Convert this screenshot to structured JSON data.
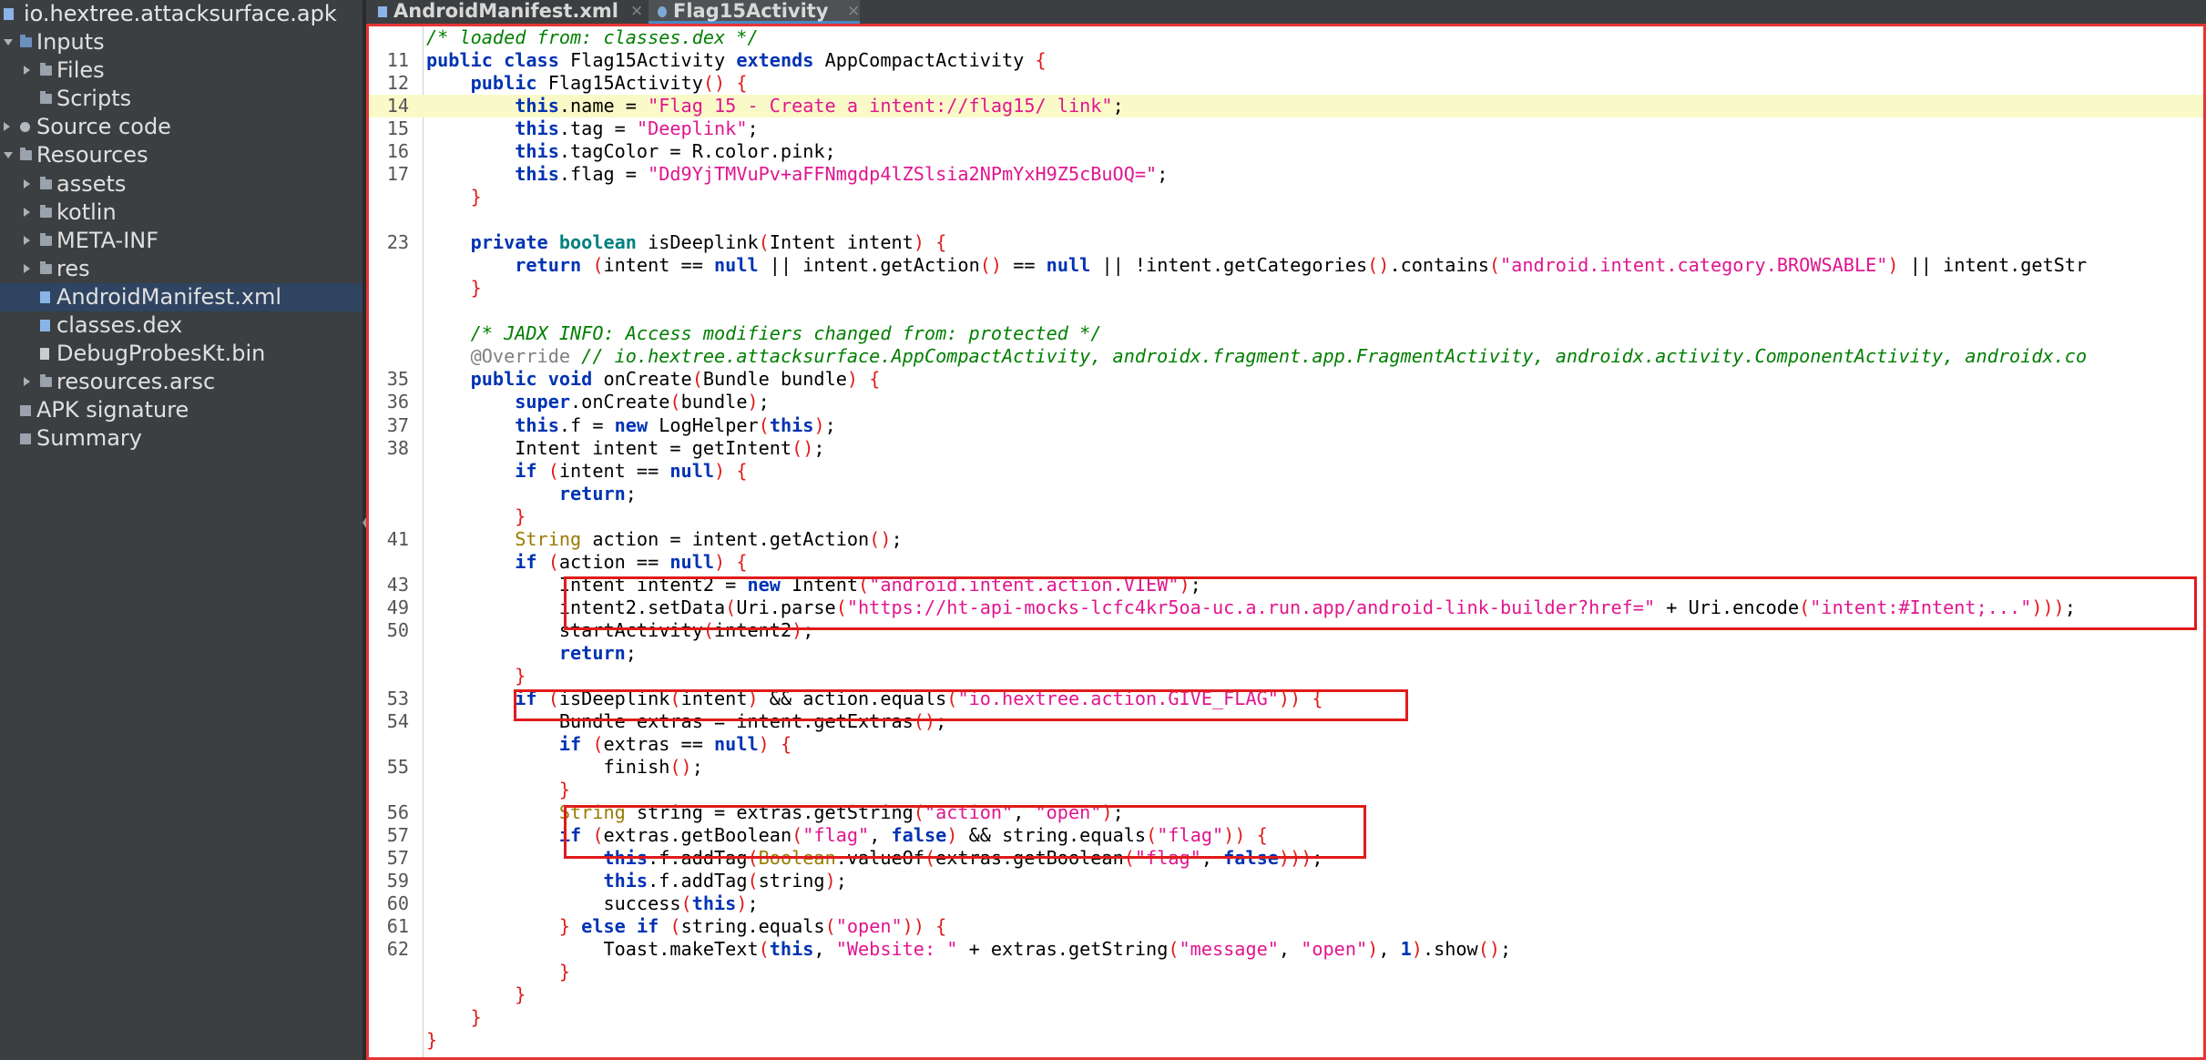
{
  "project": {
    "title": "io.hextree.attacksurface.apk"
  },
  "tree": [
    {
      "label": "Inputs",
      "arrow": "down",
      "icon": "inputs-icon",
      "indent": 0
    },
    {
      "label": "Files",
      "arrow": "right",
      "icon": "folder-icon",
      "indent": 1
    },
    {
      "label": "Scripts",
      "arrow": "",
      "icon": "folder-icon",
      "indent": 1
    },
    {
      "label": "Source code",
      "arrow": "right",
      "icon": "package-icon",
      "indent": 0
    },
    {
      "label": "Resources",
      "arrow": "down",
      "icon": "folder-icon",
      "indent": 0
    },
    {
      "label": "assets",
      "arrow": "right",
      "icon": "folder-icon",
      "indent": 1
    },
    {
      "label": "kotlin",
      "arrow": "right",
      "icon": "folder-icon",
      "indent": 1
    },
    {
      "label": "META-INF",
      "arrow": "right",
      "icon": "folder-icon",
      "indent": 1
    },
    {
      "label": "res",
      "arrow": "right",
      "icon": "folder-icon",
      "indent": 1
    },
    {
      "label": "AndroidManifest.xml",
      "arrow": "",
      "icon": "xml-file-icon",
      "indent": 1,
      "selected": true
    },
    {
      "label": "classes.dex",
      "arrow": "",
      "icon": "dex-file-icon",
      "indent": 1
    },
    {
      "label": "DebugProbesKt.bin",
      "arrow": "",
      "icon": "file-icon",
      "indent": 1
    },
    {
      "label": "resources.arsc",
      "arrow": "right",
      "icon": "folder-icon",
      "indent": 1
    },
    {
      "label": "APK signature",
      "arrow": "",
      "icon": "signature-icon",
      "indent": 0
    },
    {
      "label": "Summary",
      "arrow": "",
      "icon": "summary-icon",
      "indent": 0
    }
  ],
  "tabs": [
    {
      "label": "AndroidManifest.xml",
      "active": false,
      "close": "×"
    },
    {
      "label": "Flag15Activity",
      "active": true,
      "close": "×"
    }
  ],
  "code": [
    {
      "ln": "",
      "spans": [
        [
          "cm",
          "/* loaded from: classes.dex */"
        ]
      ]
    },
    {
      "ln": "11",
      "spans": [
        [
          "kw",
          "public class "
        ],
        [
          "",
          "Flag15Activity "
        ],
        [
          "kw",
          "extends "
        ],
        [
          "",
          "AppCompactActivity "
        ],
        [
          "pr",
          "{"
        ]
      ]
    },
    {
      "ln": "12",
      "spans": [
        [
          "",
          "    "
        ],
        [
          "kw",
          "public "
        ],
        [
          "",
          "Flag15Activity"
        ],
        [
          "pr",
          "() {"
        ]
      ]
    },
    {
      "ln": "14",
      "hl": true,
      "spans": [
        [
          "",
          "        "
        ],
        [
          "kw",
          "this"
        ],
        [
          "",
          ".name = "
        ],
        [
          "str",
          "\"Flag 15 - Create a intent://flag15/ link\""
        ],
        [
          "",
          ";"
        ]
      ]
    },
    {
      "ln": "15",
      "spans": [
        [
          "",
          "        "
        ],
        [
          "kw",
          "this"
        ],
        [
          "",
          ".tag = "
        ],
        [
          "str",
          "\"Deeplink\""
        ],
        [
          "",
          ";"
        ]
      ]
    },
    {
      "ln": "16",
      "spans": [
        [
          "",
          "        "
        ],
        [
          "kw",
          "this"
        ],
        [
          "",
          ".tagColor = R.color.pink;"
        ]
      ]
    },
    {
      "ln": "17",
      "spans": [
        [
          "",
          "        "
        ],
        [
          "kw",
          "this"
        ],
        [
          "",
          ".flag = "
        ],
        [
          "str",
          "\"Dd9YjTMVuPv+aFFNmgdp4lZSlsia2NPmYxH9Z5cBuOQ=\""
        ],
        [
          "",
          ";"
        ]
      ]
    },
    {
      "ln": "",
      "spans": [
        [
          "",
          "    "
        ],
        [
          "pr",
          "}"
        ]
      ]
    },
    {
      "ln": "",
      "spans": [
        [
          "",
          ""
        ]
      ]
    },
    {
      "ln": "23",
      "spans": [
        [
          "",
          "    "
        ],
        [
          "kw",
          "private "
        ],
        [
          "kw2",
          "boolean "
        ],
        [
          "",
          "isDeeplink"
        ],
        [
          "pr",
          "("
        ],
        [
          "",
          "Intent intent"
        ],
        [
          "pr",
          ") {"
        ]
      ]
    },
    {
      "ln": "",
      "spans": [
        [
          "",
          "        "
        ],
        [
          "kw",
          "return "
        ],
        [
          "pr",
          "("
        ],
        [
          "",
          "intent == "
        ],
        [
          "kw",
          "null "
        ],
        [
          "",
          "|| intent.getAction"
        ],
        [
          "pr",
          "()"
        ],
        [
          "",
          " == "
        ],
        [
          "kw",
          "null "
        ],
        [
          "",
          "|| !intent.getCategories"
        ],
        [
          "pr",
          "()"
        ],
        [
          "",
          ".contains"
        ],
        [
          "pr",
          "("
        ],
        [
          "str",
          "\"android.intent.category.BROWSABLE\""
        ],
        [
          "pr",
          ")"
        ],
        [
          "",
          " || intent.getStr"
        ]
      ]
    },
    {
      "ln": "",
      "spans": [
        [
          "",
          "    "
        ],
        [
          "pr",
          "}"
        ]
      ]
    },
    {
      "ln": "",
      "spans": [
        [
          "",
          ""
        ]
      ]
    },
    {
      "ln": "",
      "spans": [
        [
          "",
          "    "
        ],
        [
          "cm",
          "/* JADX INFO: Access modifiers changed from: protected */"
        ]
      ]
    },
    {
      "ln": "",
      "spans": [
        [
          "",
          "    "
        ],
        [
          "ann",
          "@Override "
        ],
        [
          "cm",
          "// io.hextree.attacksurface.AppCompactActivity, androidx.fragment.app.FragmentActivity, androidx.activity.ComponentActivity, androidx.co"
        ]
      ]
    },
    {
      "ln": "35",
      "spans": [
        [
          "",
          "    "
        ],
        [
          "kw",
          "public void "
        ],
        [
          "",
          "onCreate"
        ],
        [
          "pr",
          "("
        ],
        [
          "",
          "Bundle bundle"
        ],
        [
          "pr",
          ") {"
        ]
      ]
    },
    {
      "ln": "36",
      "spans": [
        [
          "",
          "        "
        ],
        [
          "kw",
          "super"
        ],
        [
          "",
          ".onCreate"
        ],
        [
          "pr",
          "("
        ],
        [
          "",
          "bundle"
        ],
        [
          "pr",
          ")"
        ],
        [
          "",
          ";"
        ]
      ]
    },
    {
      "ln": "37",
      "spans": [
        [
          "",
          "        "
        ],
        [
          "kw",
          "this"
        ],
        [
          "",
          ".f = "
        ],
        [
          "kw",
          "new "
        ],
        [
          "",
          "LogHelper"
        ],
        [
          "pr",
          "("
        ],
        [
          "kw",
          "this"
        ],
        [
          "pr",
          ")"
        ],
        [
          "",
          ";"
        ]
      ]
    },
    {
      "ln": "38",
      "spans": [
        [
          "",
          "        Intent intent = getIntent"
        ],
        [
          "pr",
          "()"
        ],
        [
          "",
          ";"
        ]
      ]
    },
    {
      "ln": "",
      "spans": [
        [
          "",
          "        "
        ],
        [
          "kw",
          "if "
        ],
        [
          "pr",
          "("
        ],
        [
          "",
          "intent == "
        ],
        [
          "kw",
          "null"
        ],
        [
          "pr",
          ") {"
        ]
      ]
    },
    {
      "ln": "",
      "spans": [
        [
          "",
          "            "
        ],
        [
          "kw",
          "return"
        ],
        [
          "",
          ";"
        ]
      ]
    },
    {
      "ln": "",
      "spans": [
        [
          "",
          "        "
        ],
        [
          "pr",
          "}"
        ]
      ]
    },
    {
      "ln": "41",
      "spans": [
        [
          "",
          "        "
        ],
        [
          "ty",
          "String "
        ],
        [
          "",
          "action = intent.getAction"
        ],
        [
          "pr",
          "()"
        ],
        [
          "",
          ";"
        ]
      ]
    },
    {
      "ln": "",
      "spans": [
        [
          "",
          "        "
        ],
        [
          "kw",
          "if "
        ],
        [
          "pr",
          "("
        ],
        [
          "",
          "action == "
        ],
        [
          "kw",
          "null"
        ],
        [
          "pr",
          ") {"
        ]
      ]
    },
    {
      "ln": "43",
      "spans": [
        [
          "",
          "            Intent intent2 = "
        ],
        [
          "kw",
          "new "
        ],
        [
          "",
          "Intent"
        ],
        [
          "pr",
          "("
        ],
        [
          "str",
          "\"android.intent.action.VIEW\""
        ],
        [
          "pr",
          ")"
        ],
        [
          "",
          ";"
        ]
      ]
    },
    {
      "ln": "49",
      "spans": [
        [
          "",
          "            intent2.setData"
        ],
        [
          "pr",
          "("
        ],
        [
          "",
          "Uri.parse"
        ],
        [
          "pr",
          "("
        ],
        [
          "str",
          "\"https://ht-api-mocks-lcfc4kr5oa-uc.a.run.app/android-link-builder?href=\""
        ],
        [
          "",
          " + Uri.encode"
        ],
        [
          "pr",
          "("
        ],
        [
          "str",
          "\"intent:#Intent;...\""
        ],
        [
          "pr",
          ")))"
        ],
        [
          "",
          ";"
        ]
      ]
    },
    {
      "ln": "50",
      "spans": [
        [
          "",
          "            startActivity"
        ],
        [
          "pr",
          "("
        ],
        [
          "",
          "intent2"
        ],
        [
          "pr",
          ")"
        ],
        [
          "",
          ";"
        ]
      ]
    },
    {
      "ln": "",
      "spans": [
        [
          "",
          "            "
        ],
        [
          "kw",
          "return"
        ],
        [
          "",
          ";"
        ]
      ]
    },
    {
      "ln": "",
      "spans": [
        [
          "",
          "        "
        ],
        [
          "pr",
          "}"
        ]
      ]
    },
    {
      "ln": "53",
      "spans": [
        [
          "",
          "        "
        ],
        [
          "kw",
          "if "
        ],
        [
          "pr",
          "("
        ],
        [
          "",
          "isDeeplink"
        ],
        [
          "pr",
          "("
        ],
        [
          "",
          "intent"
        ],
        [
          "pr",
          ")"
        ],
        [
          "",
          " && action.equals"
        ],
        [
          "pr",
          "("
        ],
        [
          "str",
          "\"io.hextree.action.GIVE_FLAG\""
        ],
        [
          "pr",
          ")) {"
        ]
      ]
    },
    {
      "ln": "54",
      "spans": [
        [
          "",
          "            Bundle extras = intent.getExtras"
        ],
        [
          "pr",
          "()"
        ],
        [
          "",
          ";"
        ]
      ]
    },
    {
      "ln": "",
      "spans": [
        [
          "",
          "            "
        ],
        [
          "kw",
          "if "
        ],
        [
          "pr",
          "("
        ],
        [
          "",
          "extras == "
        ],
        [
          "kw",
          "null"
        ],
        [
          "pr",
          ") {"
        ]
      ]
    },
    {
      "ln": "55",
      "spans": [
        [
          "",
          "                finish"
        ],
        [
          "pr",
          "()"
        ],
        [
          "",
          ";"
        ]
      ]
    },
    {
      "ln": "",
      "spans": [
        [
          "",
          "            "
        ],
        [
          "pr",
          "}"
        ]
      ]
    },
    {
      "ln": "56",
      "spans": [
        [
          "",
          "            "
        ],
        [
          "ty",
          "String "
        ],
        [
          "",
          "string = extras.getString"
        ],
        [
          "pr",
          "("
        ],
        [
          "str",
          "\"action\""
        ],
        [
          "",
          ", "
        ],
        [
          "str",
          "\"open\""
        ],
        [
          "pr",
          ")"
        ],
        [
          "",
          ";"
        ]
      ]
    },
    {
      "ln": "57",
      "spans": [
        [
          "",
          "            "
        ],
        [
          "kw",
          "if "
        ],
        [
          "pr",
          "("
        ],
        [
          "",
          "extras.getBoolean"
        ],
        [
          "pr",
          "("
        ],
        [
          "str",
          "\"flag\""
        ],
        [
          "",
          ", "
        ],
        [
          "kw",
          "false"
        ],
        [
          "pr",
          ")"
        ],
        [
          "",
          " && string.equals"
        ],
        [
          "pr",
          "("
        ],
        [
          "str",
          "\"flag\""
        ],
        [
          "pr",
          ")) {"
        ]
      ]
    },
    {
      "ln": "57",
      "spans": [
        [
          "",
          "                "
        ],
        [
          "kw",
          "this"
        ],
        [
          "",
          ".f.addTag"
        ],
        [
          "pr",
          "("
        ],
        [
          "ty",
          "Boolean"
        ],
        [
          "",
          ".valueOf"
        ],
        [
          "pr",
          "("
        ],
        [
          "",
          "extras.getBoolean"
        ],
        [
          "pr",
          "("
        ],
        [
          "str",
          "\"flag\""
        ],
        [
          "",
          ", "
        ],
        [
          "kw",
          "false"
        ],
        [
          "pr",
          ")))"
        ],
        [
          "",
          ";"
        ]
      ]
    },
    {
      "ln": "59",
      "spans": [
        [
          "",
          "                "
        ],
        [
          "kw",
          "this"
        ],
        [
          "",
          ".f.addTag"
        ],
        [
          "pr",
          "("
        ],
        [
          "",
          "string"
        ],
        [
          "pr",
          ")"
        ],
        [
          "",
          ";"
        ]
      ]
    },
    {
      "ln": "60",
      "spans": [
        [
          "",
          "                success"
        ],
        [
          "pr",
          "("
        ],
        [
          "kw",
          "this"
        ],
        [
          "pr",
          ")"
        ],
        [
          "",
          ";"
        ]
      ]
    },
    {
      "ln": "61",
      "spans": [
        [
          "",
          "            "
        ],
        [
          "pr",
          "} "
        ],
        [
          "kw",
          "else if "
        ],
        [
          "pr",
          "("
        ],
        [
          "",
          "string.equals"
        ],
        [
          "pr",
          "("
        ],
        [
          "str",
          "\"open\""
        ],
        [
          "pr",
          ")) {"
        ]
      ]
    },
    {
      "ln": "62",
      "spans": [
        [
          "",
          "                Toast.makeText"
        ],
        [
          "pr",
          "("
        ],
        [
          "kw",
          "this"
        ],
        [
          "",
          ", "
        ],
        [
          "str",
          "\"Website: \""
        ],
        [
          "",
          " + extras.getString"
        ],
        [
          "pr",
          "("
        ],
        [
          "str",
          "\"message\""
        ],
        [
          "",
          ", "
        ],
        [
          "str",
          "\"open\""
        ],
        [
          "pr",
          ")"
        ],
        [
          "",
          ", "
        ],
        [
          "kw",
          "1"
        ],
        [
          "pr",
          ")"
        ],
        [
          "",
          ".show"
        ],
        [
          "pr",
          "()"
        ],
        [
          "",
          ";"
        ]
      ]
    },
    {
      "ln": "",
      "spans": [
        [
          "",
          "            "
        ],
        [
          "pr",
          "}"
        ]
      ]
    },
    {
      "ln": "",
      "spans": [
        [
          "",
          "        "
        ],
        [
          "pr",
          "}"
        ]
      ]
    },
    {
      "ln": "",
      "spans": [
        [
          "",
          "    "
        ],
        [
          "pr",
          "}"
        ]
      ]
    },
    {
      "ln": "",
      "spans": [
        [
          "pr",
          "}"
        ]
      ]
    }
  ],
  "colors": {
    "editor_bg": "#ffffff",
    "highlight_box": "#e01b1b",
    "current_line": "#fafac8",
    "selection": "#2f4461"
  }
}
